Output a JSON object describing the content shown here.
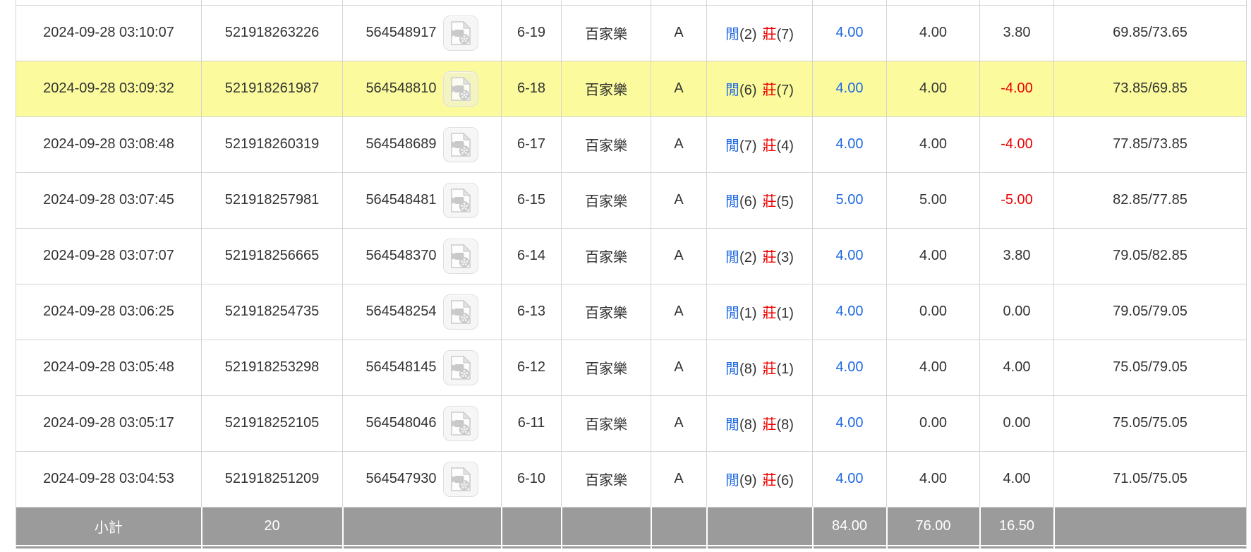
{
  "labels": {
    "player": "閒",
    "banker": "莊"
  },
  "icons": {
    "round_video": "video-file-icon"
  },
  "colors": {
    "bet_amount_blue": "#1f6ae2",
    "negative_red": "#ee0000",
    "highlight_yellow": "#fbfb9e",
    "summary_gray": "#9b9b9b",
    "grid_border": "#d4d4d4"
  },
  "rows": [
    {
      "time": "2024-09-28 03:10:07",
      "bet_id": "521918263226",
      "round_id": "564548917",
      "shoe": "6-19",
      "game": "百家樂",
      "table": "A",
      "p": "(2)",
      "b": "(7)",
      "bet": "4.00",
      "valid": "4.00",
      "win": "3.80",
      "balance": "69.85/73.65",
      "highlight": false
    },
    {
      "time": "2024-09-28 03:09:32",
      "bet_id": "521918261987",
      "round_id": "564548810",
      "shoe": "6-18",
      "game": "百家樂",
      "table": "A",
      "p": "(6)",
      "b": "(7)",
      "bet": "4.00",
      "valid": "4.00",
      "win": "-4.00",
      "balance": "73.85/69.85",
      "highlight": true
    },
    {
      "time": "2024-09-28 03:08:48",
      "bet_id": "521918260319",
      "round_id": "564548689",
      "shoe": "6-17",
      "game": "百家樂",
      "table": "A",
      "p": "(7)",
      "b": "(4)",
      "bet": "4.00",
      "valid": "4.00",
      "win": "-4.00",
      "balance": "77.85/73.85",
      "highlight": false
    },
    {
      "time": "2024-09-28 03:07:45",
      "bet_id": "521918257981",
      "round_id": "564548481",
      "shoe": "6-15",
      "game": "百家樂",
      "table": "A",
      "p": "(6)",
      "b": "(5)",
      "bet": "5.00",
      "valid": "5.00",
      "win": "-5.00",
      "balance": "82.85/77.85",
      "highlight": false
    },
    {
      "time": "2024-09-28 03:07:07",
      "bet_id": "521918256665",
      "round_id": "564548370",
      "shoe": "6-14",
      "game": "百家樂",
      "table": "A",
      "p": "(2)",
      "b": "(3)",
      "bet": "4.00",
      "valid": "4.00",
      "win": "3.80",
      "balance": "79.05/82.85",
      "highlight": false
    },
    {
      "time": "2024-09-28 03:06:25",
      "bet_id": "521918254735",
      "round_id": "564548254",
      "shoe": "6-13",
      "game": "百家樂",
      "table": "A",
      "p": "(1)",
      "b": "(1)",
      "bet": "4.00",
      "valid": "0.00",
      "win": "0.00",
      "balance": "79.05/79.05",
      "highlight": false
    },
    {
      "time": "2024-09-28 03:05:48",
      "bet_id": "521918253298",
      "round_id": "564548145",
      "shoe": "6-12",
      "game": "百家樂",
      "table": "A",
      "p": "(8)",
      "b": "(1)",
      "bet": "4.00",
      "valid": "4.00",
      "win": "4.00",
      "balance": "75.05/79.05",
      "highlight": false
    },
    {
      "time": "2024-09-28 03:05:17",
      "bet_id": "521918252105",
      "round_id": "564548046",
      "shoe": "6-11",
      "game": "百家樂",
      "table": "A",
      "p": "(8)",
      "b": "(8)",
      "bet": "4.00",
      "valid": "0.00",
      "win": "0.00",
      "balance": "75.05/75.05",
      "highlight": false
    },
    {
      "time": "2024-09-28 03:04:53",
      "bet_id": "521918251209",
      "round_id": "564547930",
      "shoe": "6-10",
      "game": "百家樂",
      "table": "A",
      "p": "(9)",
      "b": "(6)",
      "bet": "4.00",
      "valid": "4.00",
      "win": "4.00",
      "balance": "71.05/75.05",
      "highlight": false
    }
  ],
  "summary": {
    "label": "小計",
    "count": "20",
    "bet_total": "84.00",
    "valid_total": "76.00",
    "win_total": "16.50"
  }
}
